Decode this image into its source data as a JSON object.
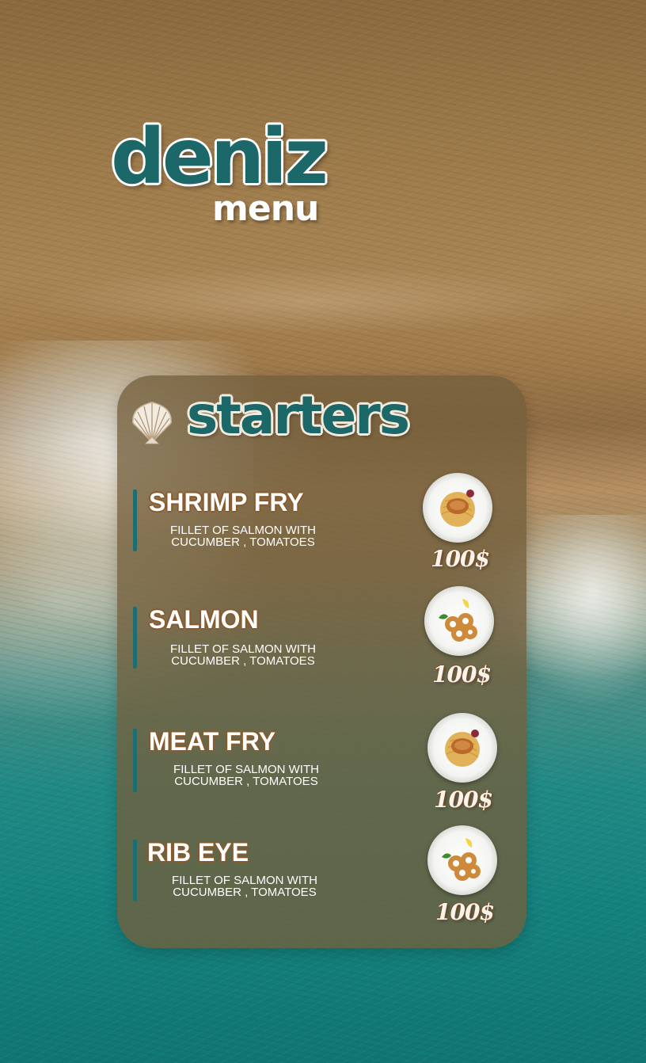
{
  "brand": {
    "name": "deniz",
    "subtitle": "menu"
  },
  "section": {
    "title": "starters",
    "icon": "seashell-icon"
  },
  "items": [
    {
      "name": "SHRIMP FRY",
      "description": "FILLET OF SALMON WITH\nCUCUMBER , TOMATOES",
      "price": "100$",
      "image": "grilled-fish-pasta-plate"
    },
    {
      "name": "SALMON",
      "description": "FILLET OF SALMON WITH\nCUCUMBER , TOMATOES",
      "price": "100$",
      "image": "fried-calamari-plate"
    },
    {
      "name": "MEAT FRY",
      "description": "FILLET OF SALMON WITH\nCUCUMBER , TOMATOES",
      "price": "100$",
      "image": "grilled-fish-pasta-plate"
    },
    {
      "name": "RIB EYE",
      "description": "FILLET OF SALMON WITH\nCUCUMBER , TOMATOES",
      "price": "100$",
      "image": "fried-calamari-plate"
    }
  ],
  "colors": {
    "teal": "#1c6768",
    "card": "#735f3c",
    "accent_bar": "#1c6e70",
    "name_outline": "#8a5a2c"
  }
}
